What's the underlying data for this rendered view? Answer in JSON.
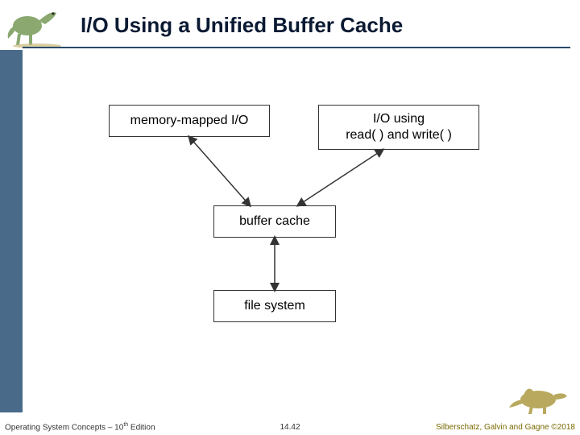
{
  "slide": {
    "title": "I/O Using a Unified Buffer Cache"
  },
  "diagram": {
    "boxes": {
      "mmio": "memory-mapped I/O",
      "rw": "I/O using\nread( ) and write( )",
      "cache": "buffer cache",
      "fs": "file system"
    }
  },
  "footer": {
    "left_prefix": "Operating System Concepts – 10",
    "left_suffix": " Edition",
    "left_sup": "th",
    "page": "14.42",
    "right": "Silberschatz, Galvin and Gagne ©2018"
  },
  "chart_data": {
    "type": "diagram",
    "nodes": [
      {
        "id": "mmio",
        "label": "memory-mapped I/O"
      },
      {
        "id": "rw",
        "label": "I/O using read( ) and write( )"
      },
      {
        "id": "cache",
        "label": "buffer cache"
      },
      {
        "id": "fs",
        "label": "file system"
      }
    ],
    "edges": [
      {
        "from": "mmio",
        "to": "cache",
        "bidirectional": true
      },
      {
        "from": "rw",
        "to": "cache",
        "bidirectional": true
      },
      {
        "from": "cache",
        "to": "fs",
        "bidirectional": true
      }
    ],
    "title": "I/O Using a Unified Buffer Cache"
  }
}
